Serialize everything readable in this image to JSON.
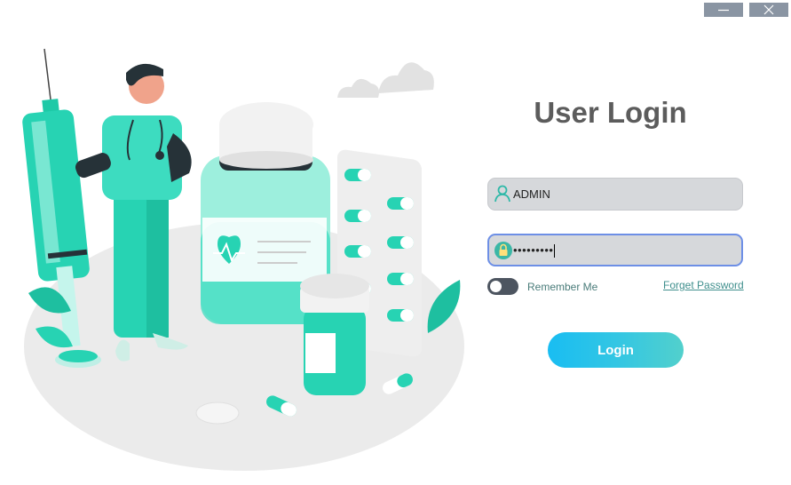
{
  "window": {
    "minimize_icon": "minimize-icon",
    "close_icon": "close-icon"
  },
  "login": {
    "title": "User Login",
    "username": {
      "value": "ADMIN",
      "icon": "user-icon"
    },
    "password": {
      "value": "•••••••••",
      "icon": "lock-icon"
    },
    "remember_label": "Remember Me",
    "remember_on": false,
    "forgot_label": "Forget Password",
    "button_label": "Login"
  },
  "colors": {
    "accent": "#2ad3be",
    "button_start": "#19bdf2",
    "button_end": "#52d0cc",
    "title": "#5c5c5c",
    "focus_border": "#6d8fe6"
  }
}
